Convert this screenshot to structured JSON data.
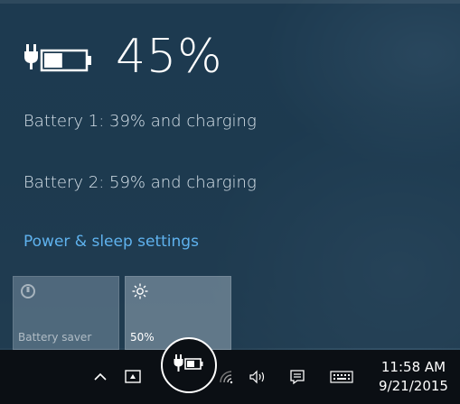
{
  "battery": {
    "percent_text": "45%",
    "percent_value": 45,
    "battery1_text": "Battery 1: 39% and charging",
    "battery2_text": "Battery 2: 59% and charging",
    "settings_link": "Power & sleep settings"
  },
  "tiles": [
    {
      "label": "Battery saver",
      "icon": "battery-saver-icon",
      "state": "off"
    },
    {
      "label": "50%",
      "icon": "brightness-icon",
      "state": "on"
    }
  ],
  "taskbar": {
    "icons": [
      "chevron-up-icon",
      "tablet-mode-icon",
      "battery-plug-icon",
      "wifi-icon",
      "volume-icon",
      "action-center-icon",
      "keyboard-icon"
    ],
    "time": "11:58 AM",
    "date": "9/21/2015"
  },
  "colors": {
    "link": "#5fb2ee",
    "taskbar": "#0b0f14",
    "text": "#ffffff"
  }
}
